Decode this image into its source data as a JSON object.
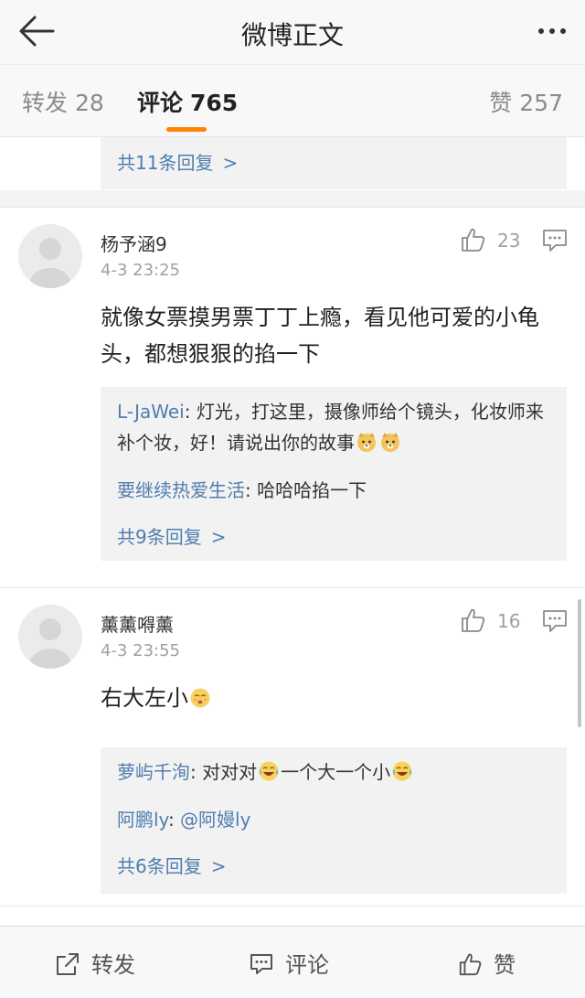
{
  "header": {
    "title": "微博正文"
  },
  "tabs": {
    "reposts": {
      "label": "转发",
      "count": "28"
    },
    "comments": {
      "label": "评论",
      "count": "765"
    },
    "likes": {
      "label": "赞",
      "count": "257"
    }
  },
  "partial": {
    "more_replies": "共11条回复"
  },
  "comments": [
    {
      "username": "杨予涵9",
      "time": "4-3 23:25",
      "likes": "23",
      "text": "就像女票摸男票丁丁上瘾，看见他可爱的小龟头，都想狠狠的掐一下",
      "replies": [
        {
          "author": "L-JaWei",
          "sep": ": ",
          "text": "灯光，打这里，摄像师给个镜头，化妆师来补个妆，好！请说出你的故事",
          "emojis": [
            "doge",
            "doge"
          ]
        },
        {
          "author": "要继续热爱生活",
          "sep": ": ",
          "text": "哈哈哈掐一下",
          "emojis": []
        }
      ],
      "more_replies": "共9条回复"
    },
    {
      "username": "薰薰嘚薰",
      "time": "4-3 23:55",
      "likes": "16",
      "text": "右大左小",
      "text_emoji": "face-emoji",
      "replies": [
        {
          "author": "萝屿千洵",
          "sep": ": ",
          "text_a": "对对对",
          "text_b": "一个大一个小",
          "emojis": [
            "laugh-cry",
            "laugh-cry"
          ]
        },
        {
          "author": "阿鹏ly",
          "sep": ": ",
          "text": "@阿嫚ly",
          "emojis": []
        }
      ],
      "more_replies": "共6条回复"
    }
  ],
  "bottombar": {
    "repost": "转发",
    "comment": "评论",
    "like": "赞"
  },
  "icons": [
    "back-arrow-icon",
    "more-dots-icon",
    "thumbs-up-icon",
    "reply-icon",
    "repost-icon",
    "comment-icon"
  ],
  "colors": {
    "accent": "#ff8200",
    "link": "#507daf"
  }
}
